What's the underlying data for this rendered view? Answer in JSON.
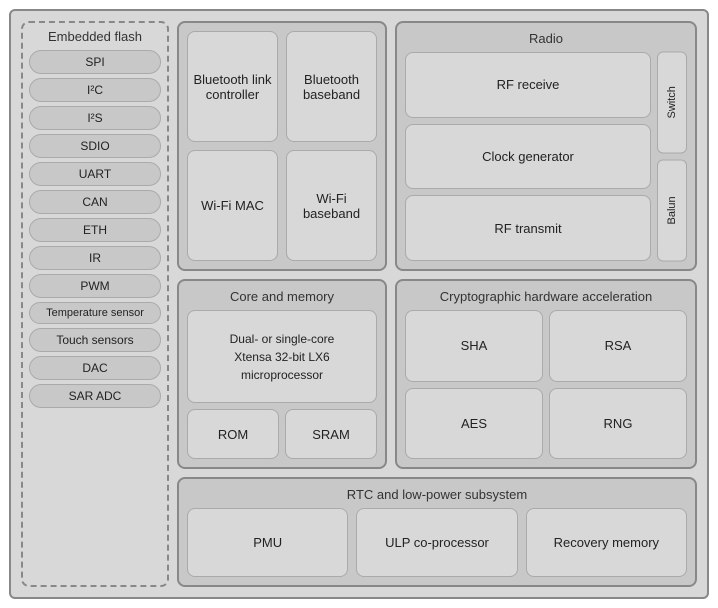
{
  "left": {
    "title": "Embedded flash",
    "pills": [
      "SPI",
      "I²C",
      "I²S",
      "SDIO",
      "UART",
      "CAN",
      "ETH",
      "IR",
      "PWM",
      "Temperature sensor",
      "Touch sensors",
      "DAC",
      "SAR ADC"
    ]
  },
  "bt_wifi": {
    "bluetooth_controller": "Bluetooth link controller",
    "bluetooth_baseband": "Bluetooth baseband",
    "wifi_mac": "Wi-Fi MAC",
    "wifi_baseband": "Wi-Fi baseband"
  },
  "radio": {
    "title": "Radio",
    "rf_receive": "RF receive",
    "clock_generator": "Clock generator",
    "rf_transmit": "RF transmit",
    "switch": "Switch",
    "balun": "Balun"
  },
  "core": {
    "title": "Core and memory",
    "processor": "Dual- or single-core\nXtensa 32-bit LX6\nmicroprocessor",
    "rom": "ROM",
    "sram": "SRAM"
  },
  "crypto": {
    "title": "Cryptographic hardware acceleration",
    "sha": "SHA",
    "rsa": "RSA",
    "aes": "AES",
    "rng": "RNG"
  },
  "rtc": {
    "title": "RTC and low-power subsystem",
    "pmu": "PMU",
    "ulp": "ULP co-processor",
    "recovery": "Recovery memory"
  }
}
